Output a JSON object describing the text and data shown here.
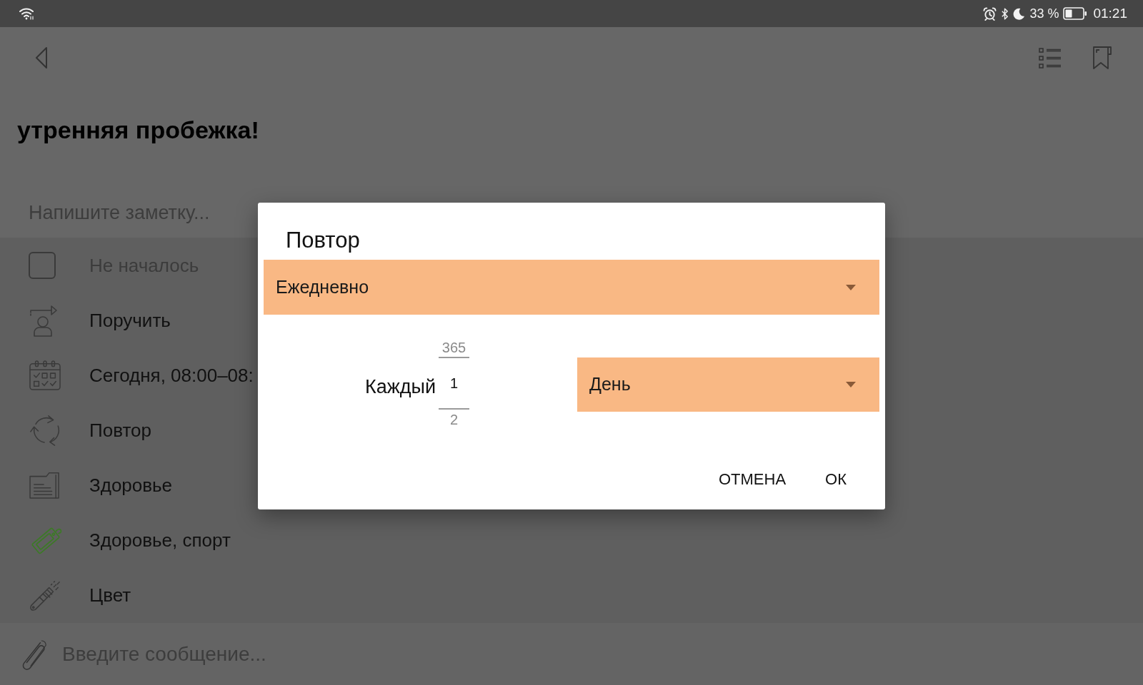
{
  "status_bar": {
    "battery": "33 %",
    "time": "01:21"
  },
  "note": {
    "title": "утренняя пробежка!",
    "placeholder": "Напишите заметку..."
  },
  "properties": [
    {
      "kind": "status",
      "label": "Не началось",
      "checked": false
    },
    {
      "kind": "assignee",
      "label": "Поручить"
    },
    {
      "kind": "date",
      "label": "Сегодня, 08:00–08:"
    },
    {
      "kind": "repeat",
      "label": "Повтор"
    },
    {
      "kind": "folder",
      "label": "Здоровье"
    },
    {
      "kind": "tag",
      "label": "Здоровье, спорт",
      "color": "#3c7a26"
    },
    {
      "kind": "color",
      "label": "Цвет"
    }
  ],
  "message": {
    "placeholder": "Введите сообщение..."
  },
  "dialog": {
    "title": "Повтор",
    "frequency": {
      "value": "Ежедневно"
    },
    "every_label": "Каждый",
    "interval": {
      "previous": "365",
      "value": "1",
      "next": "2"
    },
    "unit": {
      "value": "День"
    },
    "buttons": [
      "ОТМЕНА",
      "ОК"
    ]
  }
}
